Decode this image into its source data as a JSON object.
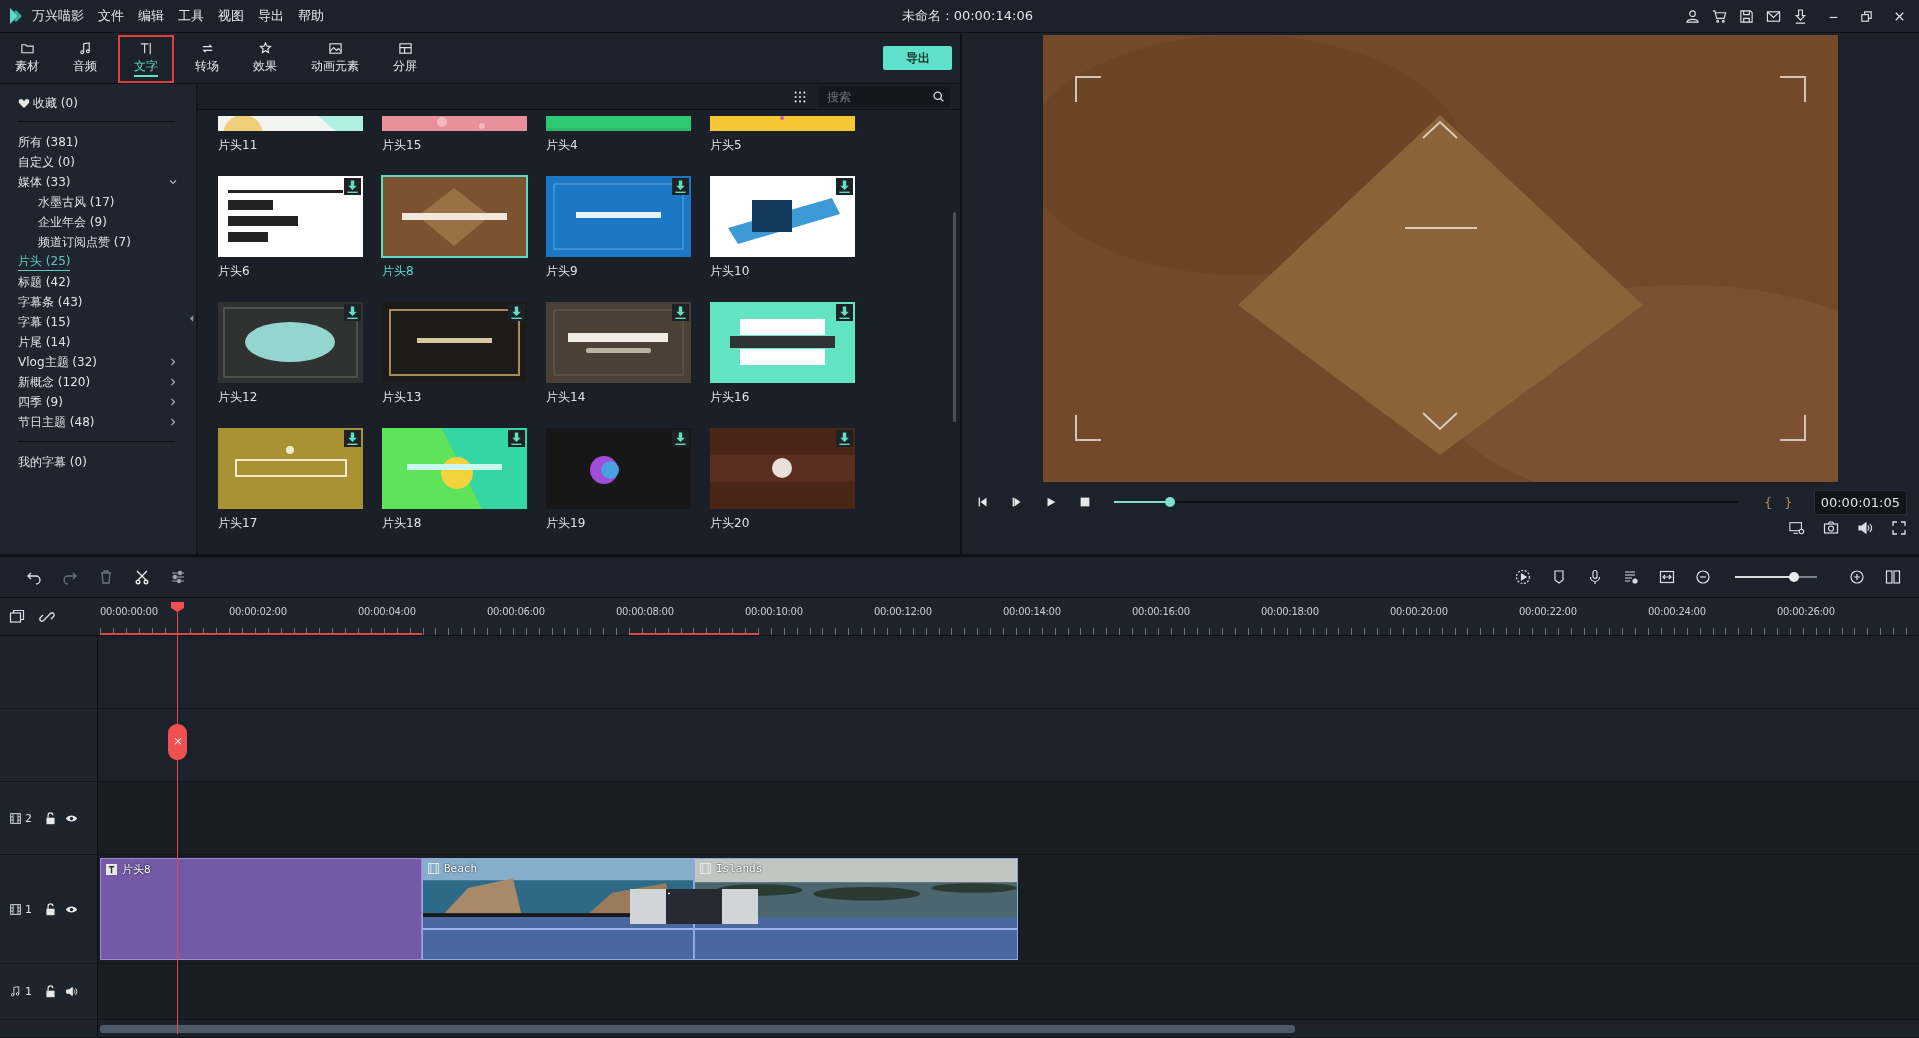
{
  "app": {
    "name": "万兴喵影",
    "menus": [
      "文件",
      "编辑",
      "工具",
      "视图",
      "导出",
      "帮助"
    ],
    "project_title": "未命名 : 00:00:14:06"
  },
  "tabs": [
    {
      "label": "素材",
      "selected": false
    },
    {
      "label": "音频",
      "selected": false
    },
    {
      "label": "文字",
      "selected": true
    },
    {
      "label": "转场",
      "selected": false
    },
    {
      "label": "效果",
      "selected": false
    },
    {
      "label": "动画元素",
      "selected": false
    },
    {
      "label": "分屏",
      "selected": false
    }
  ],
  "export_button": "导出",
  "sidebar": {
    "favorites": "收藏 (0)",
    "categories": [
      {
        "label": "所有 (381)",
        "selected": false
      },
      {
        "label": "自定义 (0)",
        "selected": false
      },
      {
        "label": "媒体 (33)",
        "selected": false,
        "expanded": true,
        "children": [
          {
            "label": "水墨古风 (17)",
            "selected": false
          },
          {
            "label": "企业年会 (9)",
            "selected": false
          },
          {
            "label": "频道订阅点赞 (7)",
            "selected": false
          }
        ]
      },
      {
        "label": "片头 (25)",
        "selected": true
      },
      {
        "label": "标题 (42)",
        "selected": false
      },
      {
        "label": "字幕条 (43)",
        "selected": false
      },
      {
        "label": "字幕 (15)",
        "selected": false
      },
      {
        "label": "片尾 (14)",
        "selected": false
      },
      {
        "label": "Vlog主题 (32)",
        "selected": false,
        "expanded": false
      },
      {
        "label": "新概念 (120)",
        "selected": false,
        "expanded": false
      },
      {
        "label": "四季 (9)",
        "selected": false,
        "expanded": false
      },
      {
        "label": "节日主题 (48)",
        "selected": false,
        "expanded": false
      }
    ],
    "my_captions": "我的字幕 (0)"
  },
  "search": {
    "placeholder": "搜索"
  },
  "templates": [
    {
      "label": "片头11",
      "selected": false,
      "download": false
    },
    {
      "label": "片头15",
      "selected": false,
      "download": false
    },
    {
      "label": "片头4",
      "selected": false,
      "download": false
    },
    {
      "label": "片头5",
      "selected": false,
      "download": false
    },
    {
      "label": "片头6",
      "selected": false,
      "download": true
    },
    {
      "label": "片头8",
      "selected": true,
      "download": false
    },
    {
      "label": "片头9",
      "selected": false,
      "download": true
    },
    {
      "label": "片头10",
      "selected": false,
      "download": true
    },
    {
      "label": "片头12",
      "selected": false,
      "download": true
    },
    {
      "label": "片头13",
      "selected": false,
      "download": true
    },
    {
      "label": "片头14",
      "selected": false,
      "download": true
    },
    {
      "label": "片头16",
      "selected": false,
      "download": true
    },
    {
      "label": "片头17",
      "selected": false,
      "download": true
    },
    {
      "label": "片头18",
      "selected": false,
      "download": true
    },
    {
      "label": "片头19",
      "selected": false,
      "download": true
    },
    {
      "label": "片头20",
      "selected": false,
      "download": true
    }
  ],
  "player": {
    "level": 0.09,
    "mark_in": "{",
    "mark_out": "}",
    "timecode": "00:00:01:05"
  },
  "timeline": {
    "zoom": {
      "level": 0.72
    },
    "ruler": [
      "00:00:00:00",
      "00:00:02:00",
      "00:00:04:00",
      "00:00:06:00",
      "00:00:08:00",
      "00:00:10:00",
      "00:00:12:00",
      "00:00:14:00",
      "00:00:16:00",
      "00:00:18:00",
      "00:00:20:00",
      "00:00:22:00",
      "00:00:24:00",
      "00:00:26:00"
    ],
    "tracks": [
      {
        "kind": "video",
        "number": "2"
      },
      {
        "kind": "video",
        "number": "1",
        "clips": [
          {
            "kind": "title",
            "label": "片头8"
          },
          {
            "kind": "video",
            "label": "Beach"
          },
          {
            "kind": "video",
            "label": "Islands"
          }
        ]
      },
      {
        "kind": "audio",
        "number": "1"
      }
    ]
  }
}
